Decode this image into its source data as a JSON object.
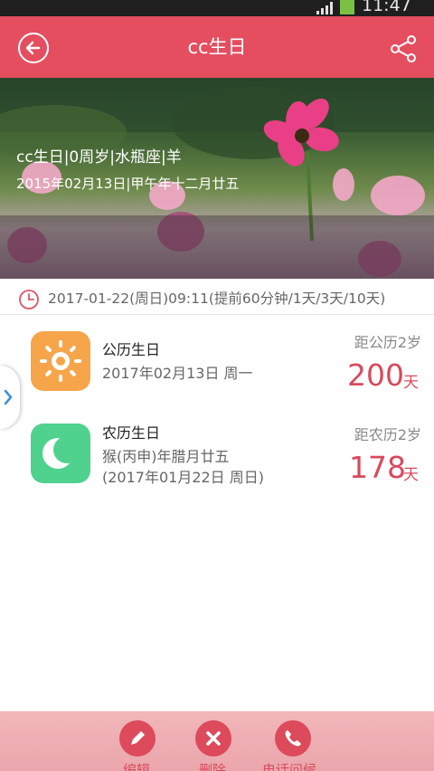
{
  "status_bar": {
    "time": "11:47"
  },
  "header": {
    "title": "cc生日"
  },
  "banner": {
    "line1": "cc生日|0周岁|水瓶座|羊",
    "line2": "2015年02月13日|甲午年十二月廿五"
  },
  "reminder": {
    "text": "2017-01-22(周日)09:11(提前60分钟/1天/3天/10天)"
  },
  "solar": {
    "title": "公历生日",
    "date": "2017年02月13日 周一",
    "label": "距公历2岁",
    "days": "200",
    "unit": "天"
  },
  "lunar": {
    "title": "农历生日",
    "date_line1": "猴(丙申)年腊月廿五",
    "date_line2": "(2017年01月22日 周日)",
    "label": "距农历2岁",
    "days": "178",
    "unit": "天"
  },
  "footer": {
    "edit_label": "编辑",
    "delete_label": "删除",
    "call_label": "电话问候"
  },
  "colors": {
    "accent": "#e44e5f",
    "days_red": "#d84a5c",
    "solar_icon": "#f7a54b",
    "lunar_icon": "#4fd28e"
  },
  "icons": {
    "back": "back-arrow-icon",
    "share": "share-icon",
    "clock": "clock-icon",
    "sun": "sun-icon",
    "moon": "moon-icon",
    "edit": "pencil-icon",
    "delete": "close-icon",
    "call": "phone-icon"
  }
}
